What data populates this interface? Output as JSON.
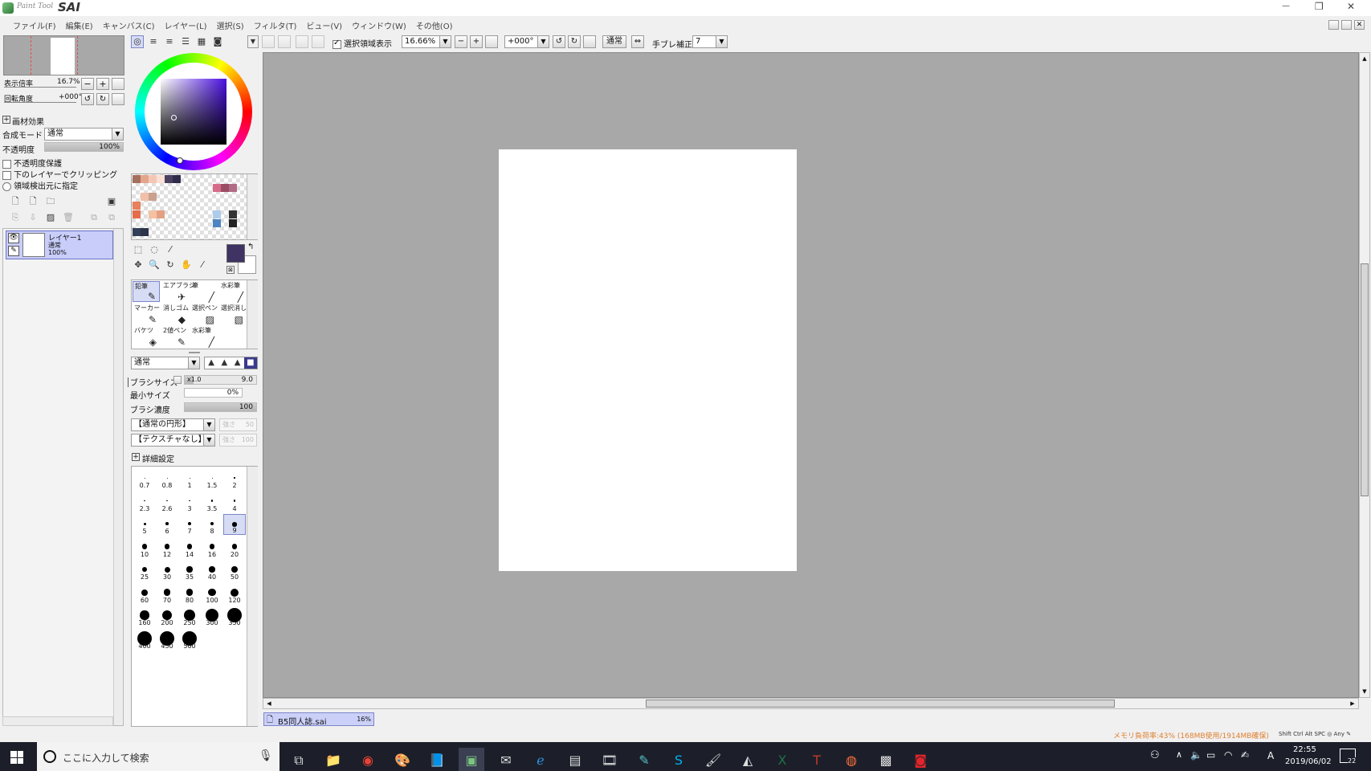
{
  "app": {
    "title": "SAI",
    "logo_text": "Paint Tool"
  },
  "window_controls": {
    "minimize": "—",
    "restore": "❐",
    "close": "✕"
  },
  "menu": [
    "ファイル(F)",
    "編集(E)",
    "キャンバス(C)",
    "レイヤー(L)",
    "選択(S)",
    "フィルタ(T)",
    "ビュー(V)",
    "ウィンドウ(W)",
    "その他(O)"
  ],
  "navigator": {
    "zoom_label": "表示倍率",
    "zoom_value": "16.7%",
    "rotation_label": "回転角度",
    "rotation_value": "+000°"
  },
  "layer_panel": {
    "effects_label": "画材効果",
    "blend_label": "合成モード",
    "blend_value": "通常",
    "opacity_label": "不透明度",
    "opacity_value": "100%",
    "opacity_fraction": 1.0,
    "protect_opacity": "不透明度保護",
    "clip_below": "下のレイヤーでクリッピング",
    "selection_source": "領域検出元に指定",
    "layer": {
      "name": "レイヤー1",
      "mode": "通常",
      "opacity": "100%"
    }
  },
  "toolbar": {
    "show_selection_label": "選択領域表示",
    "zoom_value": "16.66%",
    "angle_value": "+000°",
    "blend_value": "通常",
    "stabilizer_label": "手ブレ補正",
    "stabilizer_value": "7"
  },
  "tools": [
    {
      "label": "鉛筆",
      "glyph": "✎"
    },
    {
      "label": "エアブラシ",
      "glyph": "✈"
    },
    {
      "label": "筆",
      "glyph": "╱"
    },
    {
      "label": "水彩筆",
      "glyph": "╱"
    },
    {
      "label": "マーカー",
      "glyph": "✎"
    },
    {
      "label": "消しゴム",
      "glyph": "◆"
    },
    {
      "label": "選択ペン",
      "glyph": "▨"
    },
    {
      "label": "選択消し",
      "glyph": "▧"
    },
    {
      "label": "バケツ",
      "glyph": "◈"
    },
    {
      "label": "2値ペン",
      "glyph": "✎"
    },
    {
      "label": "水彩筆",
      "glyph": "╱"
    }
  ],
  "brush": {
    "mode_value": "通常",
    "size_label": "ブラシサイズ",
    "size_multiplier": "x1.0",
    "size_value": "9.0",
    "min_size_label": "最小サイズ",
    "min_size_value": "0%",
    "density_label": "ブラシ濃度",
    "density_value": "100",
    "shape_value": "【通常の円形】",
    "shape_strength_label": "強さ",
    "shape_strength_value": "50",
    "texture_value": "【テクスチャなし】",
    "texture_strength_label": "強さ",
    "texture_strength_value": "100",
    "advanced_label": "詳細設定",
    "sizes": [
      "0.7",
      "0.8",
      "1",
      "1.5",
      "2",
      "2.3",
      "2.6",
      "3",
      "3.5",
      "4",
      "5",
      "6",
      "7",
      "8",
      "9",
      "10",
      "12",
      "14",
      "16",
      "20",
      "25",
      "30",
      "35",
      "40",
      "50",
      "60",
      "70",
      "80",
      "100",
      "120",
      "160",
      "200",
      "250",
      "300",
      "350",
      "400",
      "450",
      "500"
    ],
    "selected_size": "9"
  },
  "colors": {
    "primary": "#3f3363",
    "secondary": "#ffffff",
    "swatches": [
      "#a4705e",
      "#e4a58c",
      "#f3c7b6",
      "#fbe0d4",
      "#4a4060",
      "#2f2b4a",
      "#ffffff",
      "#ffffff",
      "#ffffff",
      "#ffffff",
      "#ffffff",
      "#ffffff",
      "#ffffff",
      "#ffffff",
      "#ffffff",
      "#ffffff",
      "#ffffff",
      "#ffffff",
      "#ffffff",
      "#ffffff",
      "#ffffff",
      "#ffffff",
      "#ffffff",
      "#ffffff",
      "#d76c8a",
      "#9b4d63",
      "#b26b86",
      "#ffffff",
      "#ffffff",
      "#f2c0a9",
      "#caa08f",
      "#ffffff",
      "#ffffff",
      "#ffffff",
      "#ffffff",
      "#ffffff",
      "#ffffff",
      "#ffffff",
      "#ffffff",
      "#ffffff",
      "#ffffff",
      "#ffffff",
      "#e7805c",
      "#ffffff",
      "#ffffff",
      "#ffffff",
      "#ffffff",
      "#ffffff",
      "#ffffff",
      "#ffffff",
      "#ffffff",
      "#ffffff",
      "#ffffff",
      "#ffffff",
      "#ffffff",
      "#ffffff",
      "#e46d4c",
      "#ffffff",
      "#f4c1a3",
      "#e4a082",
      "#ffffff",
      "#ffffff",
      "#ffffff",
      "#ffffff",
      "#ffffff",
      "#ffffff",
      "#aecbea",
      "#ffffff",
      "#333333",
      "#ffffff",
      "#ffffff",
      "#ffffff",
      "#ffffff",
      "#ffffff",
      "#ffffff",
      "#ffffff",
      "#ffffff",
      "#ffffff",
      "#ffffff",
      "#ffffff",
      "#4e84c2",
      "#ffffff",
      "#222222",
      "#ffffff",
      "#33405a",
      "#2b3449",
      "#ffffff",
      "#ffffff",
      "#ffffff",
      "#ffffff",
      "#ffffff",
      "#ffffff",
      "#ffffff",
      "#ffffff",
      "#ffffff",
      "#ffffff",
      "#ffffff",
      "#ffffff"
    ]
  },
  "document_tab": {
    "name": "B5同人誌.sai",
    "zoom": "16%"
  },
  "status": {
    "memory": "メモリ負荷率:43% (168MB使用/1914MB確保)",
    "keys": "Shift Ctrl Alt SPC ◎ Any ✎"
  },
  "taskbar": {
    "search_placeholder": "ここに入力して検索",
    "time": "22:55",
    "date": "2019/06/02",
    "notifications": "22",
    "ime": "A",
    "apps": [
      "task-view",
      "explorer",
      "chrome",
      "paint-app",
      "notes",
      "sai",
      "mail",
      "edge",
      "ncv",
      "film",
      "clip",
      "skype",
      "paint",
      "onigiri",
      "excel",
      "tegaki",
      "firefox",
      "minecraft",
      "adobe"
    ]
  }
}
